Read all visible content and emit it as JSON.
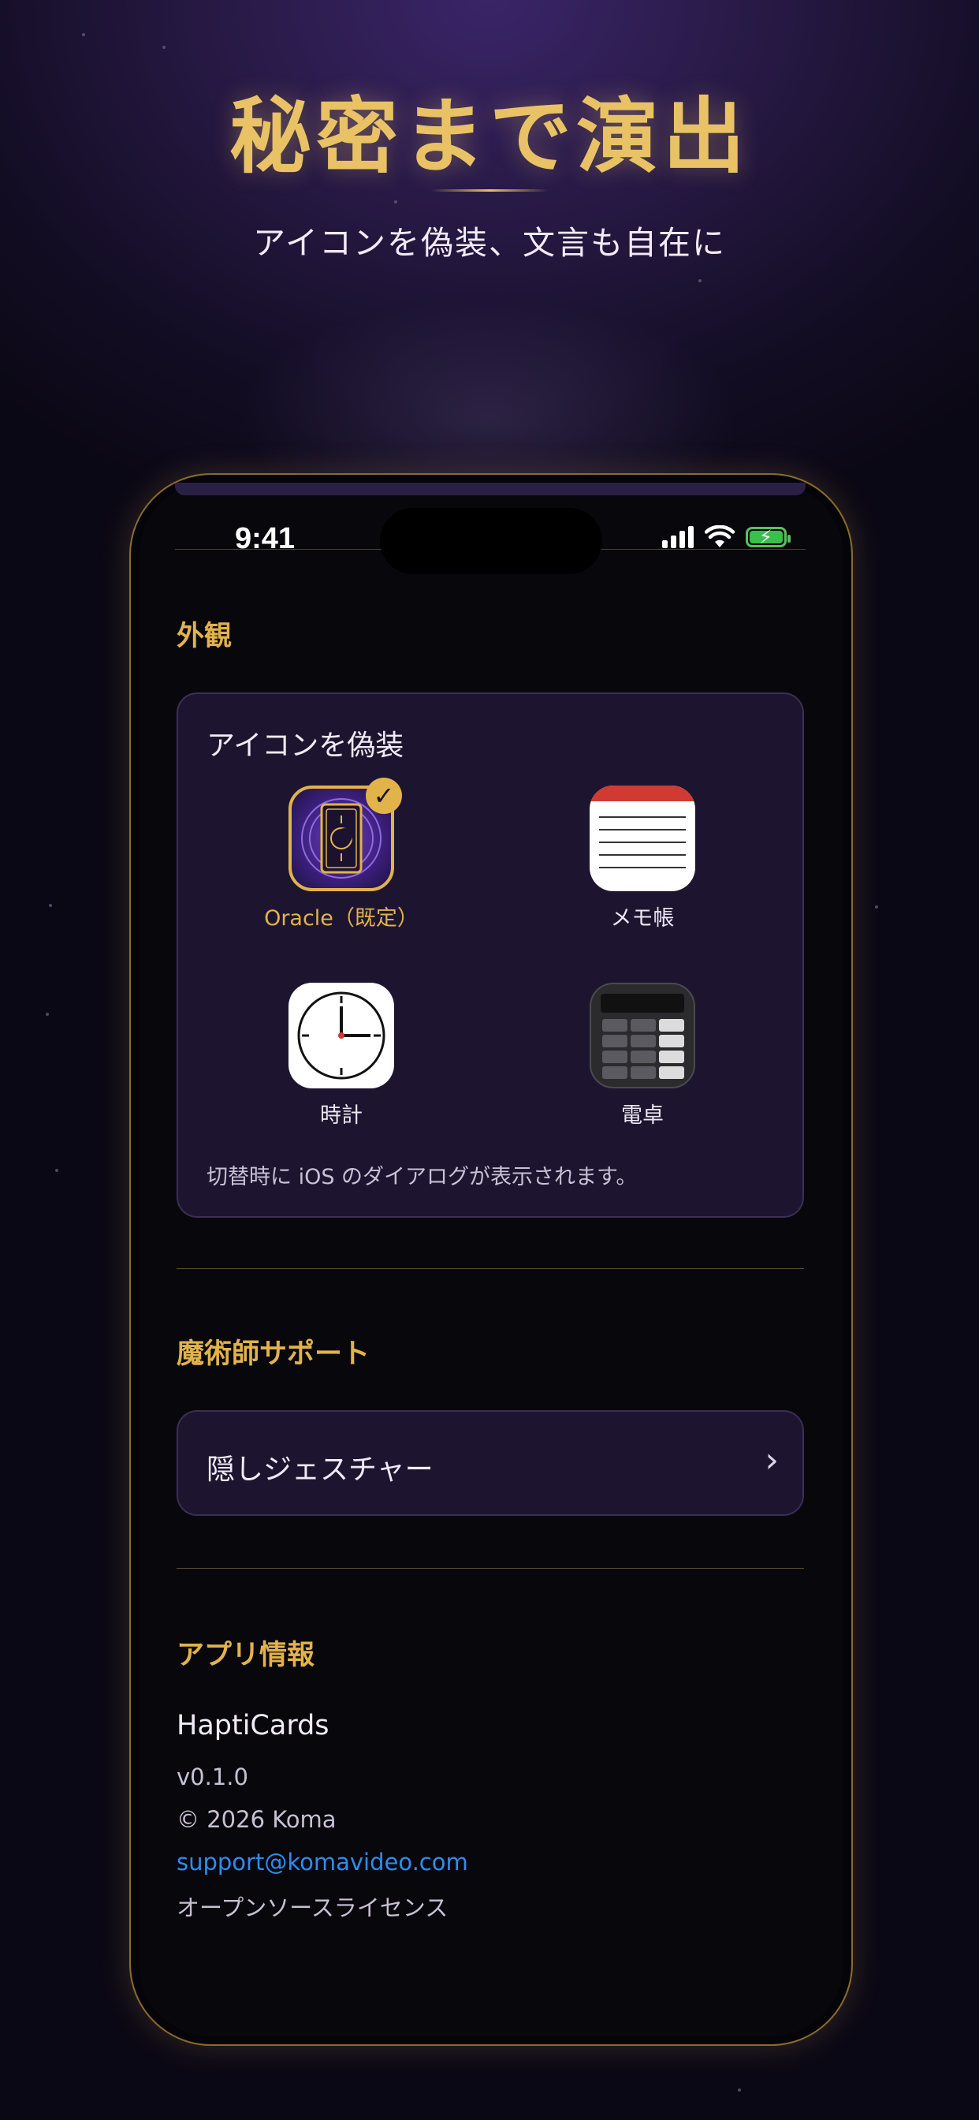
{
  "promo": {
    "headline": "秘密まで演出",
    "subhead": "アイコンを偽装、文言も自在に"
  },
  "status_bar": {
    "time": "9:41"
  },
  "appearance": {
    "section_title": "外観",
    "card_label": "アイコンを偽装",
    "icons": [
      {
        "label": "Oracle（既定）",
        "selected": true
      },
      {
        "label": "メモ帳",
        "selected": false
      },
      {
        "label": "時計",
        "selected": false
      },
      {
        "label": "電卓",
        "selected": false
      }
    ],
    "selected_check": "✓",
    "note": "切替時に iOS のダイアログが表示されます。"
  },
  "magician_support": {
    "section_title": "魔術師サポート",
    "row_label": "隠しジェスチャー",
    "chevron": "›"
  },
  "app_info": {
    "section_title": "アプリ情報",
    "app_name": "HaptiCards",
    "version": "v0.1.0",
    "copyright": "© 2026 Koma",
    "email": "support@komavideo.com",
    "licenses": "オープンソースライセンス"
  },
  "colors": {
    "accent_gold": "#e2b34b",
    "link_blue": "#2d8cf0",
    "card_bg": "#1d1530",
    "background": "#130d24"
  }
}
